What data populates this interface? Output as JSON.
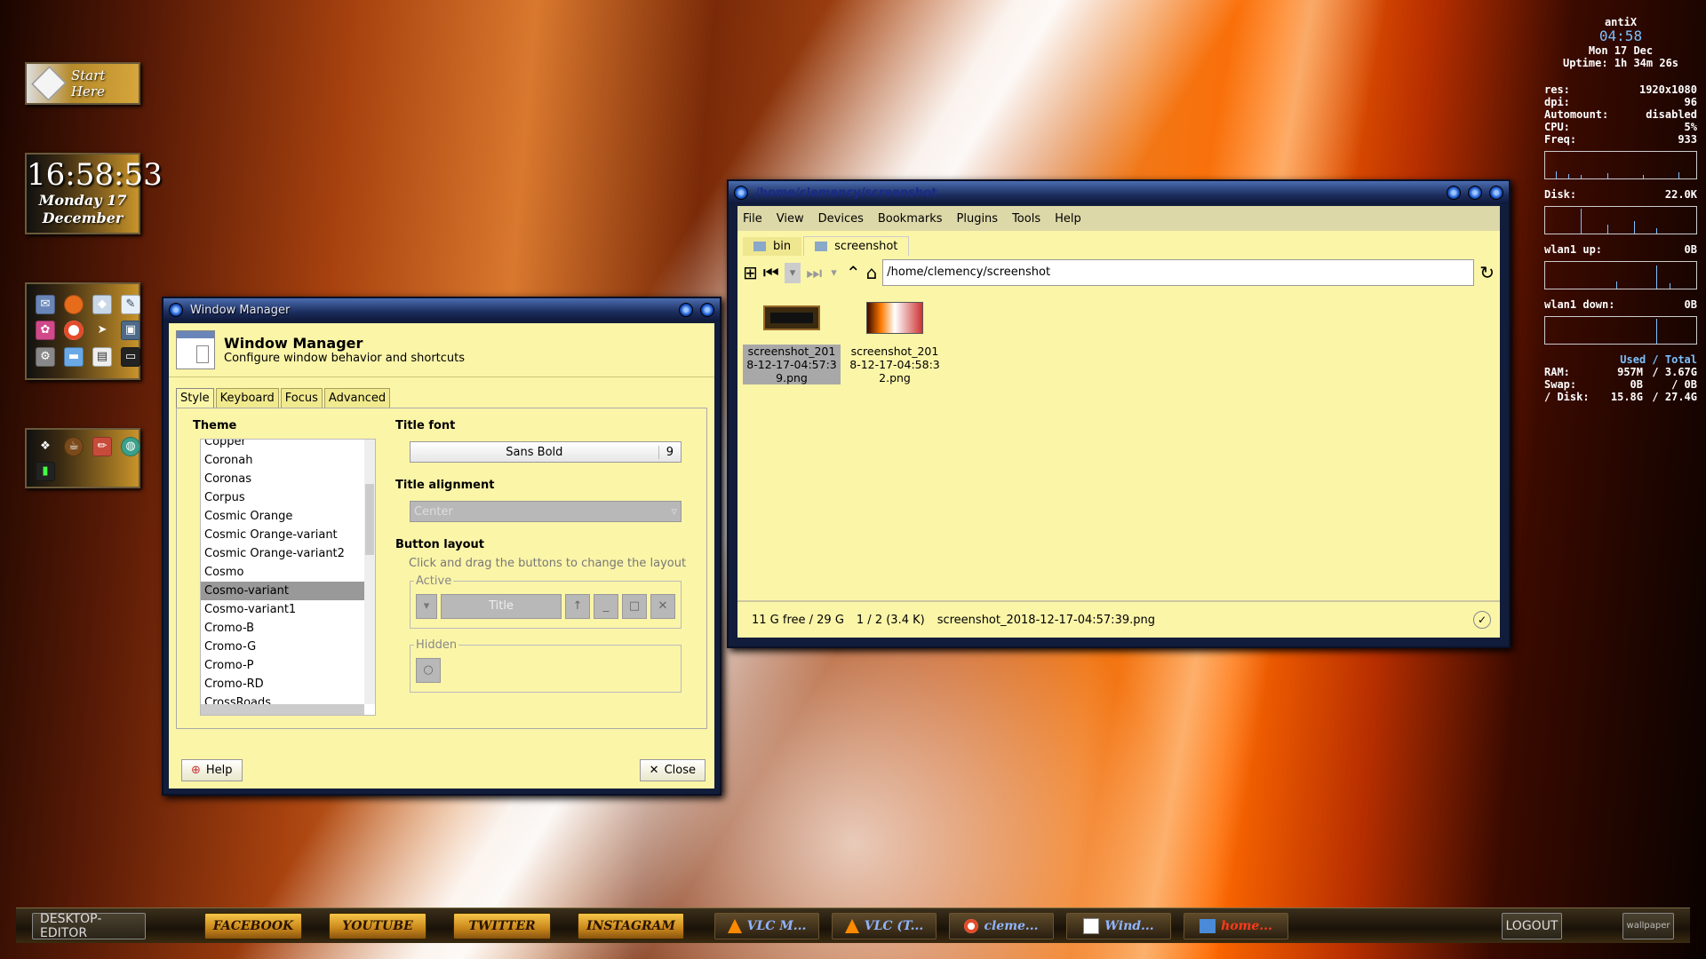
{
  "gadgets": {
    "start_label": "Start Here",
    "clock_time": "16:58:53",
    "clock_day": "Monday 17",
    "clock_month": "December"
  },
  "conky": {
    "host": "antiX",
    "time": "04:58",
    "date": "Mon 17 Dec",
    "uptime": "Uptime: 1h 34m 26s",
    "stats": [
      {
        "label": "res:",
        "value": "1920x1080"
      },
      {
        "label": "dpi:",
        "value": "96"
      },
      {
        "label": "Automount:",
        "value": "disabled"
      },
      {
        "label": "CPU:",
        "value": "5%"
      },
      {
        "label": "Freq:",
        "value": "933"
      }
    ],
    "disk_label": "Disk:",
    "disk_value": "22.0K",
    "up_label": "wlan1 up:",
    "up_value": "0B",
    "down_label": "wlan1 down:",
    "down_value": "0B",
    "used_total": "Used / Total",
    "mem": [
      {
        "label": "RAM:",
        "used": "957M",
        "total": "/ 3.67G"
      },
      {
        "label": "Swap:",
        "used": "0B",
        "total": "/ 0B"
      },
      {
        "label": "/ Disk:",
        "used": "15.8G",
        "total": "/ 27.4G"
      }
    ]
  },
  "wm": {
    "title": "Window Manager",
    "heading": "Window Manager",
    "subheading": "Configure window behavior and shortcuts",
    "tabs": [
      "Style",
      "Keyboard",
      "Focus",
      "Advanced"
    ],
    "theme_label": "Theme",
    "themes": [
      "Copper",
      "Coronah",
      "Coronas",
      "Corpus",
      "Cosmic Orange",
      "Cosmic Orange-variant",
      "Cosmic Orange-variant2",
      "Cosmo",
      "Cosmo-variant",
      "Cosmo-variant1",
      "Cromo-B",
      "Cromo-G",
      "Cromo-P",
      "Cromo-RD",
      "CrossRoads"
    ],
    "selected_theme": "Cosmo-variant",
    "title_font_label": "Title font",
    "title_font": "Sans Bold",
    "title_font_size": "9",
    "title_alignment_label": "Title alignment",
    "title_alignment": "Center",
    "button_layout_label": "Button layout",
    "button_layout_hint": "Click and drag the buttons to change the layout",
    "active_label": "Active",
    "title_btn": "Title",
    "hidden_label": "Hidden",
    "help": "Help",
    "close": "Close"
  },
  "fm": {
    "title": "/home/clemency/screenshot",
    "menu": [
      "File",
      "View",
      "Devices",
      "Bookmarks",
      "Plugins",
      "Tools",
      "Help"
    ],
    "tabs": [
      "bin",
      "screenshot"
    ],
    "path": "/home/clemency/screenshot",
    "files": [
      {
        "name": "screenshot_201\n8-12-17-04:57:3\n9.png"
      },
      {
        "name": "screenshot_201\n8-12-17-04:58:3\n2.png"
      }
    ],
    "status_free": "11 G free / 29 G",
    "status_count": "1 / 2 (3.4 K)",
    "status_file": "screenshot_2018-12-17-04:57:39.png"
  },
  "taskbar": {
    "desktop_editor": "DESKTOP-EDITOR",
    "links": [
      "FACEBOOK",
      "YOUTUBE",
      "TWITTER",
      "INSTAGRAM"
    ],
    "tasks": [
      "VLC M...",
      "VLC (T...",
      "cleme...",
      "Wind...",
      "home..."
    ],
    "logout": "LOGOUT",
    "wallpaper": "wallpaper"
  }
}
